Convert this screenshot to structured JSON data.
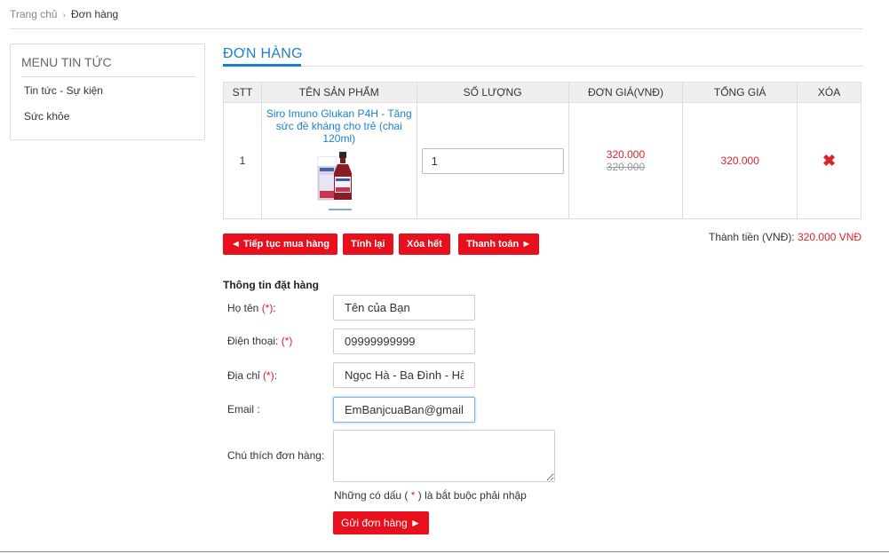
{
  "breadcrumb": {
    "home": "Trang chủ",
    "separator": "›",
    "current": "Đơn hàng"
  },
  "sidebar": {
    "title": "MENU TIN TỨC",
    "items": [
      {
        "label": "Tin tức - Sự kiện"
      },
      {
        "label": "Sức khỏe"
      }
    ]
  },
  "page": {
    "title": "ĐƠN HÀNG"
  },
  "cart": {
    "headers": [
      "STT",
      "TÊN SẢN PHẨM",
      "SỐ LƯỢNG",
      "ĐƠN GIÁ(VNĐ)",
      "TỔNG GIÁ",
      "XÓA"
    ],
    "rows": [
      {
        "stt": "1",
        "name": "Siro Imuno Glukan P4H - Tăng sức đề kháng cho trẻ (chai 120ml)",
        "quantity": "1",
        "unit_price": "320.000",
        "old_price": "320.000",
        "total": "320.000",
        "delete_icon": "✖"
      }
    ]
  },
  "actions": {
    "continue": "◄ Tiếp tục mua hàng",
    "recalc": "Tính lại",
    "clear": "Xóa hết",
    "checkout": "Thanh toán ►"
  },
  "summary": {
    "label": "Thành tiền (VNĐ):",
    "value": "320.000 VNĐ"
  },
  "order_form": {
    "title": "Thông tin đặt hàng",
    "required_mark": "(*)",
    "fields": {
      "name": {
        "label": "Họ tên",
        "value": "Tên của Bạn"
      },
      "phone": {
        "label": "Điện thoại:",
        "value": "09999999999"
      },
      "address": {
        "label": "Địa chỉ",
        "value": "Ngọc Hà - Ba Đình - Hà Nội"
      },
      "email": {
        "label": "Email :",
        "value": "EmBanjcuaBan@gmail.com"
      },
      "note": {
        "label": "Chú thích đơn hàng:",
        "value": ""
      }
    },
    "required_note": {
      "before": "Những có dấu (",
      "mark": " * ",
      "after": ") là bắt buộc phải nhập"
    },
    "submit": "Gửi đơn hàng ►"
  },
  "colors": {
    "accent": "#1b7fd0",
    "danger": "#e8101c",
    "price": "#d9232d"
  }
}
